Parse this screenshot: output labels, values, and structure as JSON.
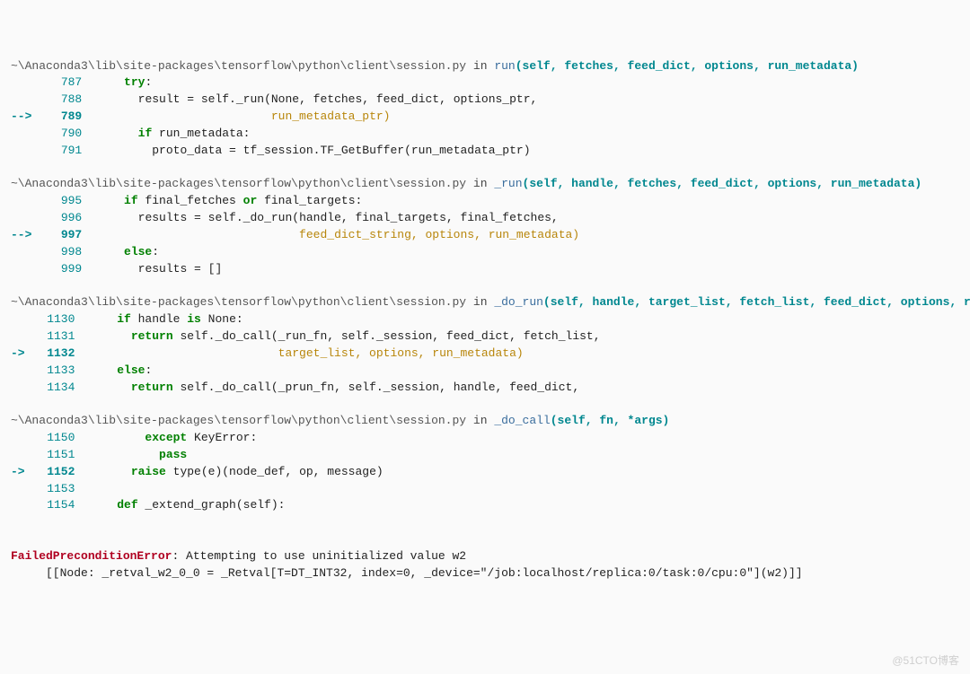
{
  "frames": [
    {
      "path": "~\\Anaconda3\\lib\\site-packages\\tensorflow\\python\\client\\session.py",
      "in_word": " in ",
      "fn": "run",
      "sig": "(self, fetches, feed_dict, options, run_metadata)",
      "lines": [
        {
          "no": "787",
          "arrow": "   ",
          "seg": [
            {
              "cls": "kw",
              "t": "try"
            },
            {
              "cls": "txt",
              "t": ":"
            }
          ],
          "indent": "      "
        },
        {
          "no": "788",
          "arrow": "   ",
          "seg": [
            {
              "cls": "txt",
              "t": "result = self._run(None, fetches, feed_dict, options_ptr,"
            }
          ],
          "indent": "        "
        },
        {
          "no": "789",
          "arrow": "-->",
          "seg": [
            {
              "cls": "call",
              "t": "                           run_metadata_ptr)"
            }
          ],
          "indent": ""
        },
        {
          "no": "790",
          "arrow": "   ",
          "seg": [
            {
              "cls": "kw",
              "t": "if"
            },
            {
              "cls": "txt",
              "t": " run_metadata:"
            }
          ],
          "indent": "        "
        },
        {
          "no": "791",
          "arrow": "   ",
          "seg": [
            {
              "cls": "txt",
              "t": "proto_data = tf_session.TF_GetBuffer(run_metadata_ptr)"
            }
          ],
          "indent": "          "
        }
      ]
    },
    {
      "path": "~\\Anaconda3\\lib\\site-packages\\tensorflow\\python\\client\\session.py",
      "in_word": " in ",
      "fn": "_run",
      "sig": "(self, handle, fetches, feed_dict, options, run_metadata)",
      "lines": [
        {
          "no": "995",
          "arrow": "   ",
          "seg": [
            {
              "cls": "kw",
              "t": "if"
            },
            {
              "cls": "txt",
              "t": " final_fetches "
            },
            {
              "cls": "kw",
              "t": "or"
            },
            {
              "cls": "txt",
              "t": " final_targets:"
            }
          ],
          "indent": "      "
        },
        {
          "no": "996",
          "arrow": "   ",
          "seg": [
            {
              "cls": "txt",
              "t": "results = self._do_run(handle, final_targets, final_fetches,"
            }
          ],
          "indent": "        "
        },
        {
          "no": "997",
          "arrow": "-->",
          "seg": [
            {
              "cls": "call",
              "t": "                               feed_dict_string, options, run_metadata)"
            }
          ],
          "indent": ""
        },
        {
          "no": "998",
          "arrow": "   ",
          "seg": [
            {
              "cls": "kw",
              "t": "else"
            },
            {
              "cls": "txt",
              "t": ":"
            }
          ],
          "indent": "      "
        },
        {
          "no": "999",
          "arrow": "   ",
          "seg": [
            {
              "cls": "txt",
              "t": "results = []"
            }
          ],
          "indent": "        "
        }
      ]
    },
    {
      "path": "~\\Anaconda3\\lib\\site-packages\\tensorflow\\python\\client\\session.py",
      "in_word": " in ",
      "fn": "_do_run",
      "sig": "(self, handle, target_list, fetch_list, feed_dict, options, run_metadata)",
      "lines": [
        {
          "no": "1130",
          "arrow": "  ",
          "seg": [
            {
              "cls": "kw",
              "t": "if"
            },
            {
              "cls": "txt",
              "t": " handle "
            },
            {
              "cls": "kw",
              "t": "is"
            },
            {
              "cls": "txt",
              "t": " None:"
            }
          ],
          "indent": "      "
        },
        {
          "no": "1131",
          "arrow": "  ",
          "seg": [
            {
              "cls": "kw",
              "t": "return"
            },
            {
              "cls": "txt",
              "t": " self._do_call(_run_fn, self._session, feed_dict, fetch_list,"
            }
          ],
          "indent": "        "
        },
        {
          "no": "1132",
          "arrow": "->",
          "seg": [
            {
              "cls": "call",
              "t": "                             target_list, options, run_metadata)"
            }
          ],
          "indent": ""
        },
        {
          "no": "1133",
          "arrow": "  ",
          "seg": [
            {
              "cls": "kw",
              "t": "else"
            },
            {
              "cls": "txt",
              "t": ":"
            }
          ],
          "indent": "      "
        },
        {
          "no": "1134",
          "arrow": "  ",
          "seg": [
            {
              "cls": "kw",
              "t": "return"
            },
            {
              "cls": "txt",
              "t": " self._do_call(_prun_fn, self._session, handle, feed_dict,"
            }
          ],
          "indent": "        "
        }
      ]
    },
    {
      "path": "~\\Anaconda3\\lib\\site-packages\\tensorflow\\python\\client\\session.py",
      "in_word": " in ",
      "fn": "_do_call",
      "sig": "(self, fn, *args)",
      "lines": [
        {
          "no": "1150",
          "arrow": "  ",
          "seg": [
            {
              "cls": "kw",
              "t": "except"
            },
            {
              "cls": "txt",
              "t": " KeyError:"
            }
          ],
          "indent": "          "
        },
        {
          "no": "1151",
          "arrow": "  ",
          "seg": [
            {
              "cls": "kw",
              "t": "pass"
            }
          ],
          "indent": "            "
        },
        {
          "no": "1152",
          "arrow": "->",
          "seg": [
            {
              "cls": "kw",
              "t": "raise"
            },
            {
              "cls": "txt",
              "t": " type(e)(node_def, op, message)"
            }
          ],
          "indent": "        "
        },
        {
          "no": "1153",
          "arrow": "  ",
          "seg": [],
          "indent": ""
        },
        {
          "no": "1154",
          "arrow": "  ",
          "seg": [
            {
              "cls": "kw",
              "t": "def"
            },
            {
              "cls": "txt",
              "t": " _extend_graph(self):"
            }
          ],
          "indent": "      "
        }
      ]
    }
  ],
  "error": {
    "name": "FailedPreconditionError",
    "msg1": ": Attempting to use uninitialized value w2",
    "msg2": "     [[Node: _retval_w2_0_0 = _Retval[T=DT_INT32, index=0, _device=\"/job:localhost/replica:0/task:0/cpu:0\"](w2)]]"
  },
  "watermark": "@51CTO博客"
}
